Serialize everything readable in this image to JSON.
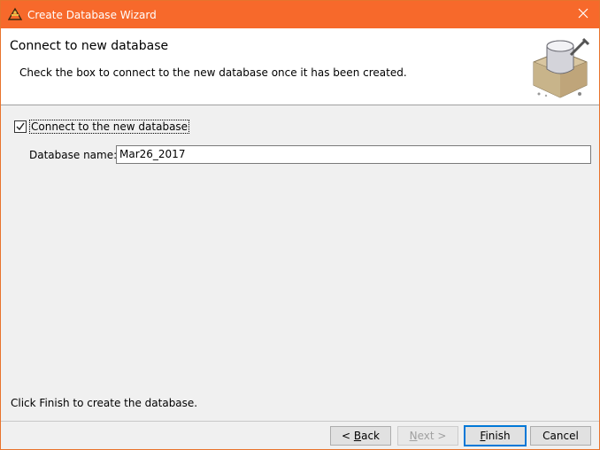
{
  "window": {
    "title": "Create Database Wizard",
    "accent_color": "#f7692b",
    "app_icon": "wizard-app-icon",
    "close_icon": "close-icon"
  },
  "header": {
    "title": "Connect to new database",
    "description": "Check the box to connect to the new database once it has been created.",
    "image": "database-illustration"
  },
  "form": {
    "connect_checkbox": {
      "label": "Connect to the new database",
      "checked": true
    },
    "database_name": {
      "label": "Database name:",
      "value": "Mar26_2017"
    }
  },
  "footer": {
    "hint": "Click Finish to create the database."
  },
  "buttons": {
    "back_prefix": "< ",
    "back_mnemonic": "B",
    "back_rest": "ack",
    "next_mnemonic": "N",
    "next_rest": "ext >",
    "finish_mnemonic": "F",
    "finish_rest": "inish",
    "cancel": "Cancel"
  }
}
